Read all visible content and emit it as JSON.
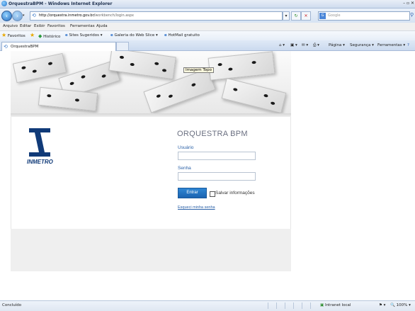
{
  "window": {
    "title": "OrquestraBPM - Windows Internet Explorer",
    "controls": "– ▫ ✕"
  },
  "address_bar": {
    "url_host": "http://orquestra.inmetro.gov.br/",
    "url_path": "workbench/login.aspx",
    "search_placeholder": "Google"
  },
  "menu": {
    "items": [
      "Arquivo",
      "Editar",
      "Exibir",
      "Favoritos",
      "Ferramentas",
      "Ajuda"
    ]
  },
  "favorites_bar": {
    "favorites_label": "Favoritos",
    "items": [
      "Histórico",
      "Sites Sugeridos ▾",
      "Galeria do Web Slice ▾",
      "HotMail gratuito"
    ]
  },
  "tabs": [
    {
      "label": "OrquestraBPM"
    }
  ],
  "command_bar": {
    "items": [
      "Página ▾",
      "Segurança ▾",
      "Ferramentas ▾"
    ]
  },
  "banner": {
    "alt_tag": "Imagem Topo"
  },
  "logo": {
    "text": "INMETRO"
  },
  "login": {
    "title": "ORQUESTRA BPM",
    "user_label": "Usuário",
    "user_value": "",
    "password_label": "Senha",
    "password_value": "",
    "submit_label": "Entrar",
    "remember_label": "Salvar informações",
    "forgot_link": "Esqueci minha senha"
  },
  "status_bar": {
    "status": "Concluído",
    "zone": "Intranet local",
    "zoom": "100%"
  },
  "colors": {
    "brand_blue": "#103a78",
    "button_blue": "#1b63b0",
    "link_blue": "#2c62a8"
  }
}
